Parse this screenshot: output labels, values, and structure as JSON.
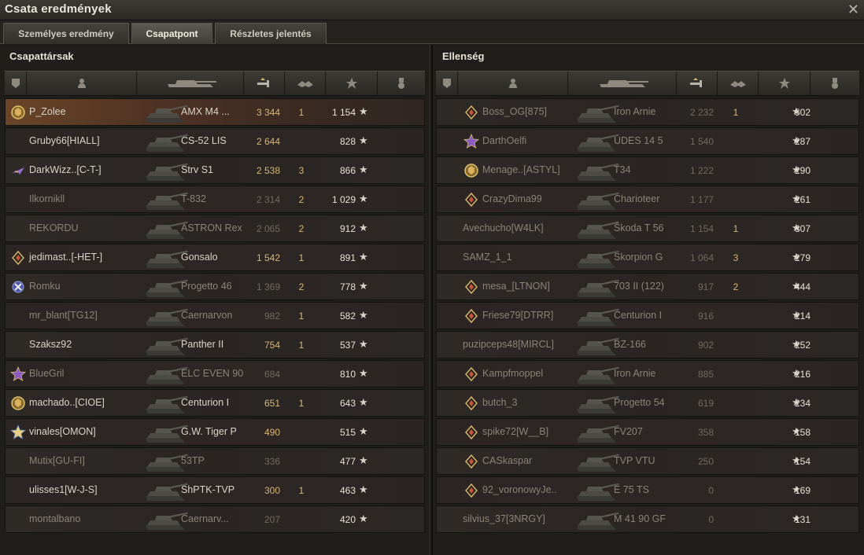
{
  "window": {
    "title": "Csata eredmények",
    "close_glyph": "✕"
  },
  "tabs": [
    {
      "label": "Személyes eredmény",
      "active": false
    },
    {
      "label": "Csapatpont",
      "active": true
    },
    {
      "label": "Részletes jelentés",
      "active": false
    }
  ],
  "columns_icons": [
    "platoon-icon",
    "player-icon",
    "vehicle-icon",
    "damage-icon",
    "frags-icon",
    "xp-star-icon",
    "medal-icon"
  ],
  "allies": {
    "title": "Csapattársak",
    "rows": [
      {
        "name": "P_Zolee",
        "badge": "gold-wreath",
        "vehicle": "AMX M4 ...",
        "damage": "3 344",
        "kills": "1",
        "xp": "1 154",
        "player": true,
        "dead": false
      },
      {
        "name": "Gruby66[HIALL]",
        "badge": "",
        "vehicle": "CS-52 LIS",
        "damage": "2 644",
        "kills": "",
        "xp": "828",
        "player": false,
        "dead": false
      },
      {
        "name": "DarkWizz..[C-T-]",
        "badge": "purple-plane",
        "vehicle": "Strv S1",
        "damage": "2 538",
        "kills": "3",
        "xp": "866",
        "player": false,
        "dead": false
      },
      {
        "name": "Ilkornikll",
        "badge": "",
        "vehicle": "T-832",
        "damage": "2 314",
        "kills": "2",
        "xp": "1 029",
        "player": false,
        "dead": true
      },
      {
        "name": "REKORDU",
        "badge": "",
        "vehicle": "ASTRON Rex",
        "damage": "2 065",
        "kills": "2",
        "xp": "912",
        "player": false,
        "dead": true
      },
      {
        "name": "jedimast..[-HET-]",
        "badge": "diamond",
        "vehicle": "Gonsalo",
        "damage": "1 542",
        "kills": "1",
        "xp": "891",
        "player": false,
        "dead": false
      },
      {
        "name": "Romku",
        "badge": "blue-cross",
        "vehicle": "Progetto 46",
        "damage": "1 369",
        "kills": "2",
        "xp": "778",
        "player": false,
        "dead": true
      },
      {
        "name": "mr_blant[TG12]",
        "badge": "",
        "vehicle": "Caernarvon",
        "damage": "982",
        "kills": "1",
        "xp": "582",
        "player": false,
        "dead": true
      },
      {
        "name": "Szaksz92",
        "badge": "",
        "vehicle": "Panther II",
        "damage": "754",
        "kills": "1",
        "xp": "537",
        "player": false,
        "dead": false
      },
      {
        "name": "BlueGril",
        "badge": "purple-star",
        "vehicle": "ELC EVEN 90",
        "damage": "684",
        "kills": "",
        "xp": "810",
        "player": false,
        "dead": true
      },
      {
        "name": "machado..[CIOE]",
        "badge": "gold-wreath",
        "vehicle": "Centurion I",
        "damage": "651",
        "kills": "1",
        "xp": "643",
        "player": false,
        "dead": false
      },
      {
        "name": "vinales[OMON]",
        "badge": "gold-star",
        "vehicle": "G.W. Tiger P",
        "damage": "490",
        "kills": "",
        "xp": "515",
        "player": false,
        "dead": false
      },
      {
        "name": "Mutix[GU-FI]",
        "badge": "",
        "vehicle": "53TP",
        "damage": "336",
        "kills": "",
        "xp": "477",
        "player": false,
        "dead": true
      },
      {
        "name": "ulisses1[W-J-S]",
        "badge": "",
        "vehicle": "ShPTK-TVP",
        "damage": "300",
        "kills": "1",
        "xp": "463",
        "player": false,
        "dead": false
      },
      {
        "name": "montalbano",
        "badge": "",
        "vehicle": "Caernarv...",
        "damage": "207",
        "kills": "",
        "xp": "420",
        "player": false,
        "dead": true
      }
    ]
  },
  "enemies": {
    "title": "Ellenség",
    "rows": [
      {
        "name": "Boss_OG[875]",
        "badge": "diamond",
        "vehicle": "Iron Arnie",
        "damage": "2 232",
        "kills": "1",
        "xp": "502",
        "dead": true
      },
      {
        "name": "DarthOelfi",
        "badge": "purple-star",
        "vehicle": "UDES 14 5",
        "damage": "1 540",
        "kills": "",
        "xp": "287",
        "dead": true
      },
      {
        "name": "Menage..[ASTYL]",
        "badge": "gold-wreath",
        "vehicle": "T34",
        "damage": "1 222",
        "kills": "",
        "xp": "290",
        "dead": true
      },
      {
        "name": "CrazyDima99",
        "badge": "diamond",
        "vehicle": "Charioteer",
        "damage": "1 177",
        "kills": "",
        "xp": "261",
        "dead": true
      },
      {
        "name": "Avechucho[W4LK]",
        "badge": "",
        "vehicle": "Škoda T 56",
        "damage": "1 154",
        "kills": "1",
        "xp": "307",
        "dead": true
      },
      {
        "name": "SAMZ_1_1",
        "badge": "",
        "vehicle": "Skorpion G",
        "damage": "1 064",
        "kills": "3",
        "xp": "279",
        "dead": true
      },
      {
        "name": "mesa_[LTNON]",
        "badge": "diamond",
        "vehicle": "703 II (122)",
        "damage": "917",
        "kills": "2",
        "xp": "444",
        "dead": true
      },
      {
        "name": "Friese79[DTRR]",
        "badge": "diamond",
        "vehicle": "Centurion I",
        "damage": "916",
        "kills": "",
        "xp": "214",
        "dead": true
      },
      {
        "name": "puzipceps48[MIRCL]",
        "badge": "",
        "vehicle": "BZ-166",
        "damage": "902",
        "kills": "",
        "xp": "252",
        "dead": true
      },
      {
        "name": "Kampfmoppel",
        "badge": "diamond",
        "vehicle": "Iron Arnie",
        "damage": "885",
        "kills": "",
        "xp": "216",
        "dead": true
      },
      {
        "name": "butch_3",
        "badge": "diamond",
        "vehicle": "Progetto 54",
        "damage": "619",
        "kills": "",
        "xp": "234",
        "dead": true
      },
      {
        "name": "spike72[W__B]",
        "badge": "diamond",
        "vehicle": "FV207",
        "damage": "358",
        "kills": "",
        "xp": "158",
        "dead": true
      },
      {
        "name": "CASkaspar",
        "badge": "diamond",
        "vehicle": "TVP VTU",
        "damage": "250",
        "kills": "",
        "xp": "154",
        "dead": true
      },
      {
        "name": "92_voronowyJe..",
        "badge": "diamond",
        "vehicle": "E 75 TS",
        "damage": "0",
        "kills": "",
        "xp": "169",
        "dead": true
      },
      {
        "name": "silvius_37[3NRGY]",
        "badge": "",
        "vehicle": "M 41 90 GF",
        "damage": "0",
        "kills": "",
        "xp": "131",
        "dead": true
      }
    ]
  },
  "star_glyph": "★",
  "colors": {
    "accent_gold": "#d7b772",
    "player_row": "#6a4528"
  }
}
